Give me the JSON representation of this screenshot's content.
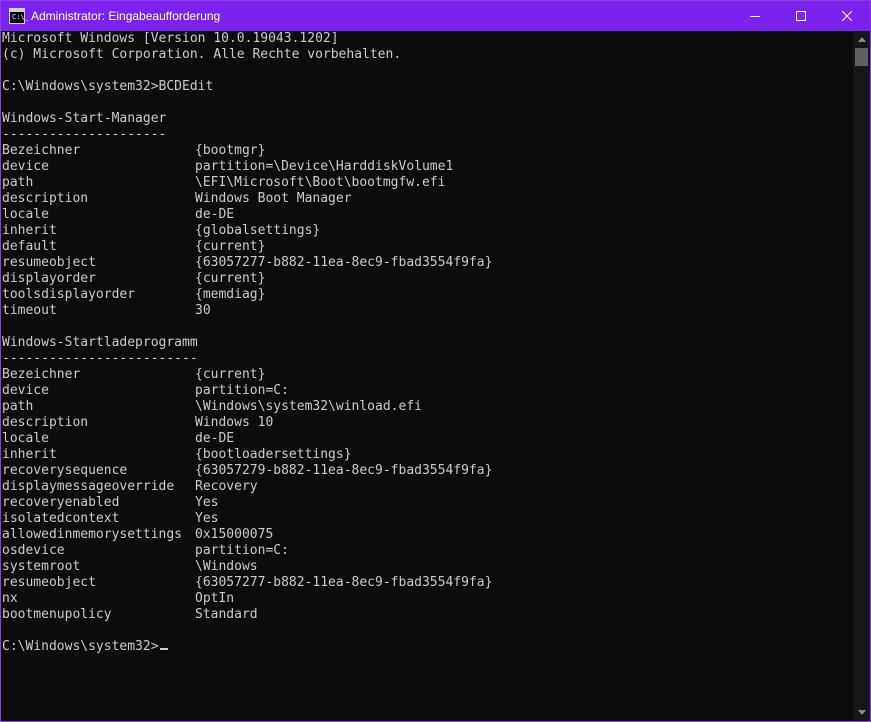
{
  "window": {
    "title": "Administrator: Eingabeaufforderung",
    "accent_color": "#7b22ec",
    "icon_prompt": "C:\\_",
    "controls": [
      "minimize-icon",
      "maximize-icon",
      "close-icon"
    ]
  },
  "console": {
    "header": [
      "Microsoft Windows [Version 10.0.19043.1202]",
      "(c) Microsoft Corporation. Alle Rechte vorbehalten."
    ],
    "command_line": "C:\\Windows\\system32>BCDEdit",
    "sections": [
      {
        "title": "Windows-Start-Manager",
        "underline": "---------------------",
        "entries": [
          {
            "key": "Bezeichner",
            "value": "{bootmgr}"
          },
          {
            "key": "device",
            "value": "partition=\\Device\\HarddiskVolume1"
          },
          {
            "key": "path",
            "value": "\\EFI\\Microsoft\\Boot\\bootmgfw.efi"
          },
          {
            "key": "description",
            "value": "Windows Boot Manager"
          },
          {
            "key": "locale",
            "value": "de-DE"
          },
          {
            "key": "inherit",
            "value": "{globalsettings}"
          },
          {
            "key": "default",
            "value": "{current}"
          },
          {
            "key": "resumeobject",
            "value": "{63057277-b882-11ea-8ec9-fbad3554f9fa}"
          },
          {
            "key": "displayorder",
            "value": "{current}"
          },
          {
            "key": "toolsdisplayorder",
            "value": "{memdiag}"
          },
          {
            "key": "timeout",
            "value": "30"
          }
        ]
      },
      {
        "title": "Windows-Startladeprogramm",
        "underline": "-------------------------",
        "entries": [
          {
            "key": "Bezeichner",
            "value": "{current}"
          },
          {
            "key": "device",
            "value": "partition=C:"
          },
          {
            "key": "path",
            "value": "\\Windows\\system32\\winload.efi"
          },
          {
            "key": "description",
            "value": "Windows 10"
          },
          {
            "key": "locale",
            "value": "de-DE"
          },
          {
            "key": "inherit",
            "value": "{bootloadersettings}"
          },
          {
            "key": "recoverysequence",
            "value": "{63057279-b882-11ea-8ec9-fbad3554f9fa}"
          },
          {
            "key": "displaymessageoverride",
            "value": "Recovery"
          },
          {
            "key": "recoveryenabled",
            "value": "Yes"
          },
          {
            "key": "isolatedcontext",
            "value": "Yes"
          },
          {
            "key": "allowedinmemorysettings",
            "value": "0x15000075"
          },
          {
            "key": "osdevice",
            "value": "partition=C:"
          },
          {
            "key": "systemroot",
            "value": "\\Windows"
          },
          {
            "key": "resumeobject",
            "value": "{63057277-b882-11ea-8ec9-fbad3554f9fa}"
          },
          {
            "key": "nx",
            "value": "OptIn"
          },
          {
            "key": "bootmenupolicy",
            "value": "Standard"
          }
        ]
      }
    ],
    "prompt": "C:\\Windows\\system32>"
  },
  "scrollbar": {
    "icons": [
      "scroll-up-arrow-icon",
      "scroll-down-arrow-icon"
    ]
  }
}
